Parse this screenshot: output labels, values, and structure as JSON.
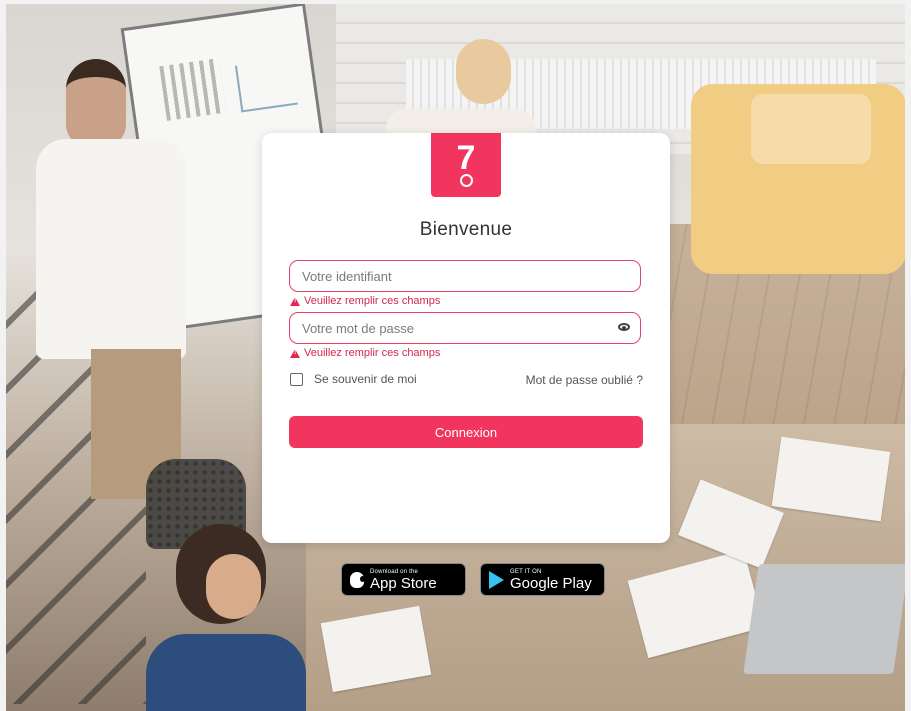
{
  "login": {
    "logo_text": "7",
    "title": "Bienvenue",
    "username_placeholder": "Votre identifiant",
    "username_error": "Veuillez remplir ces champs",
    "password_placeholder": "Votre mot de passe",
    "password_error": "Veuillez remplir ces champs",
    "remember_label": "Se souvenir de moi",
    "forgot_link": "Mot de passe oublié ?",
    "submit_label": "Connexion"
  },
  "stores": {
    "apple_small": "Download on the",
    "apple_big": "App Store",
    "google_small": "GET IT ON",
    "google_big": "Google Play"
  },
  "colors": {
    "accent": "#f2355f",
    "error": "#d0284e"
  },
  "icons": {
    "password_toggle": "eye-icon",
    "error": "warning-icon",
    "apple": "apple-icon",
    "google": "google-play-icon"
  }
}
